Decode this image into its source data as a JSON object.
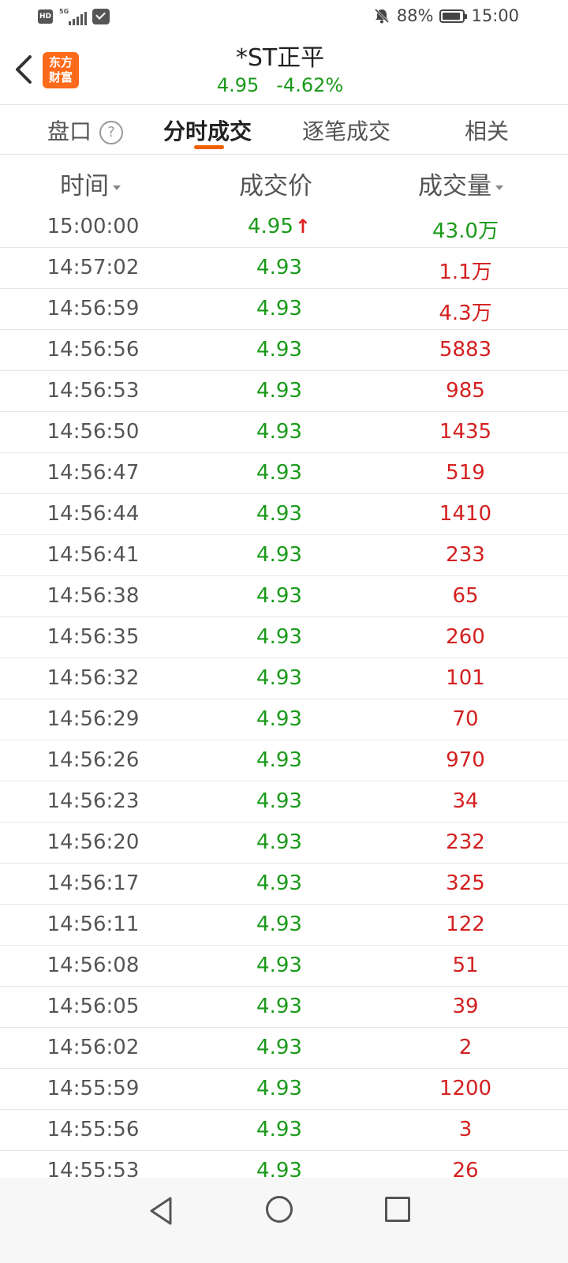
{
  "status_bar": {
    "hd": "HD",
    "network": "5G",
    "battery": "88%",
    "time": "15:00"
  },
  "header": {
    "title": "*ST正平",
    "price": "4.95",
    "change": "-4.62%",
    "logo_line1": "东方",
    "logo_line2": "财富"
  },
  "tabs": {
    "pankou": "盘口",
    "help": "?",
    "fenshi": "分时成交",
    "zhubi": "逐笔成交",
    "xiangguan": "相关"
  },
  "columns": {
    "time": "时间",
    "price": "成交价",
    "volume": "成交量"
  },
  "rows": [
    {
      "time": "15:00:00",
      "price": "4.95",
      "up_arrow": "↑",
      "volume": "43.0万"
    },
    {
      "time": "14:57:02",
      "price": "4.93",
      "volume": "1.1万"
    },
    {
      "time": "14:56:59",
      "price": "4.93",
      "volume": "4.3万"
    },
    {
      "time": "14:56:56",
      "price": "4.93",
      "volume": "5883"
    },
    {
      "time": "14:56:53",
      "price": "4.93",
      "volume": "985"
    },
    {
      "time": "14:56:50",
      "price": "4.93",
      "volume": "1435"
    },
    {
      "time": "14:56:47",
      "price": "4.93",
      "volume": "519"
    },
    {
      "time": "14:56:44",
      "price": "4.93",
      "volume": "1410"
    },
    {
      "time": "14:56:41",
      "price": "4.93",
      "volume": "233"
    },
    {
      "time": "14:56:38",
      "price": "4.93",
      "volume": "65"
    },
    {
      "time": "14:56:35",
      "price": "4.93",
      "volume": "260"
    },
    {
      "time": "14:56:32",
      "price": "4.93",
      "volume": "101"
    },
    {
      "time": "14:56:29",
      "price": "4.93",
      "volume": "70"
    },
    {
      "time": "14:56:26",
      "price": "4.93",
      "volume": "970"
    },
    {
      "time": "14:56:23",
      "price": "4.93",
      "volume": "34"
    },
    {
      "time": "14:56:20",
      "price": "4.93",
      "volume": "232"
    },
    {
      "time": "14:56:17",
      "price": "4.93",
      "volume": "325"
    },
    {
      "time": "14:56:11",
      "price": "4.93",
      "volume": "122"
    },
    {
      "time": "14:56:08",
      "price": "4.93",
      "volume": "51"
    },
    {
      "time": "14:56:05",
      "price": "4.93",
      "volume": "39"
    },
    {
      "time": "14:56:02",
      "price": "4.93",
      "volume": "2"
    },
    {
      "time": "14:55:59",
      "price": "4.93",
      "volume": "1200"
    },
    {
      "time": "14:55:56",
      "price": "4.93",
      "volume": "3"
    },
    {
      "time": "14:55:53",
      "price": "4.93",
      "volume": "26"
    }
  ],
  "colors": {
    "down_green": "#1a9a1a",
    "up_red": "#d42020",
    "accent_orange": "#f06000"
  },
  "icons": {
    "back": "chevron-left-icon",
    "help": "question-circle-icon",
    "sort": "caret-down-icon"
  }
}
